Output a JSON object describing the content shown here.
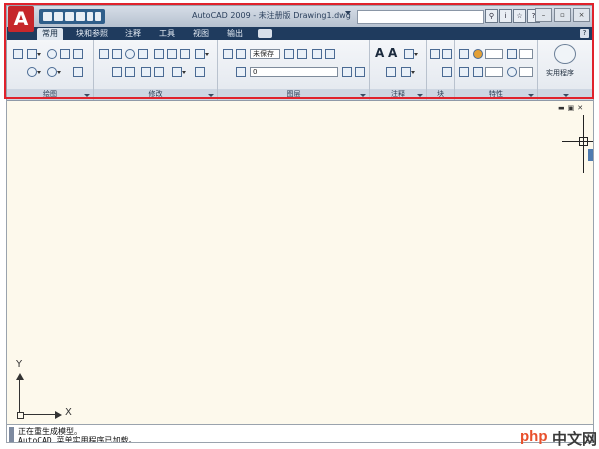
{
  "app": {
    "logo_letter": "A",
    "title": "AutoCAD 2009 - 未注册版 Drawing1.dwg",
    "brand_color": "#c6272b"
  },
  "quick_access": [
    "new-icon",
    "open-icon",
    "save-icon",
    "print-icon",
    "undo-icon",
    "redo-icon"
  ],
  "title_icons": [
    "search-icon",
    "info-icon",
    "star-icon",
    "help-icon"
  ],
  "window_controls": [
    "minimize",
    "restore",
    "close"
  ],
  "ribbon_tabs": [
    "常用",
    "块和参照",
    "注释",
    "工具",
    "视图",
    "输出"
  ],
  "active_tab": "常用",
  "panels": {
    "draw": "绘图",
    "modify": "修改",
    "layers": "图层",
    "annotation": "注释",
    "block": "块",
    "properties": "特性",
    "utilities": "实用程序"
  },
  "layer_state_combo": "未保存",
  "layer_combo": "0",
  "viewport_controls": [
    "minimize",
    "restore",
    "maximize"
  ],
  "ucs": {
    "y": "Y",
    "x": "X"
  },
  "command_line": [
    "正在重生成模型。",
    "AutoCAD 菜单实用程序已加载。"
  ],
  "watermark": {
    "php": "php",
    "site": "中文网"
  },
  "colors": {
    "canvas": "#fdf9ec",
    "tabs_bg": "#1f3b5e",
    "highlight": "#e0222c"
  }
}
